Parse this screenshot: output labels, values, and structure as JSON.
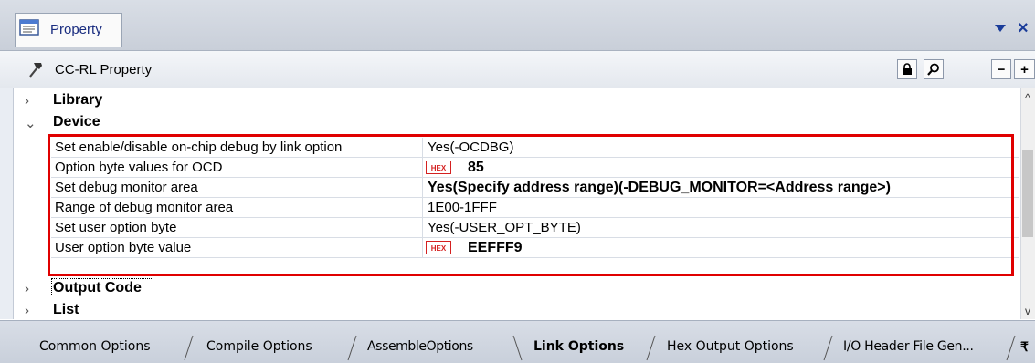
{
  "window": {
    "title": "Property",
    "close_glyph": "×",
    "pin_glyph": "▼"
  },
  "toolbar": {
    "title": "CC-RL Property",
    "lock_glyph": "🔒",
    "search_glyph": "⚲",
    "collapse_glyph": "−",
    "expand_glyph": "+"
  },
  "categories": {
    "library": {
      "label": "Library",
      "chevron": "›"
    },
    "device": {
      "label": "Device",
      "chevron": "⌄"
    },
    "output_code": {
      "label": "Output Code",
      "chevron": "›"
    },
    "list": {
      "label": "List",
      "chevron": "›"
    }
  },
  "device_properties": [
    {
      "name": "Set enable/disable on-chip debug by link option",
      "value": "Yes(-OCDBG)"
    },
    {
      "name": "Option byte values for OCD",
      "hex_badge": "HEX",
      "value": "85"
    },
    {
      "name": "Set debug monitor area",
      "value": "Yes(Specify address range)(-DEBUG_MONITOR=<Address range>)"
    },
    {
      "name": "Range of debug monitor area",
      "value": "1E00-1FFF"
    },
    {
      "name": "Set user option byte",
      "value": "Yes(-USER_OPT_BYTE)"
    },
    {
      "name": "User option byte value",
      "hex_badge": "HEX",
      "value": "EEFFF9"
    }
  ],
  "scrollbar": {
    "up_glyph": "^",
    "down_glyph": "v"
  },
  "bottom_tabs": [
    {
      "label": "Common Options",
      "active": false
    },
    {
      "label": "Compile Options",
      "active": false
    },
    {
      "label": "AssembleOptions",
      "active": false
    },
    {
      "label": "Link Options",
      "active": true
    },
    {
      "label": "Hex Output Options",
      "active": false
    },
    {
      "label": "I/O Header File Gen...",
      "active": false
    }
  ],
  "tab_overflow_glyph": "₹",
  "colors": {
    "highlight_border": "#e00000",
    "hex_badge": "#d42020",
    "title_text": "#1a2d80"
  }
}
